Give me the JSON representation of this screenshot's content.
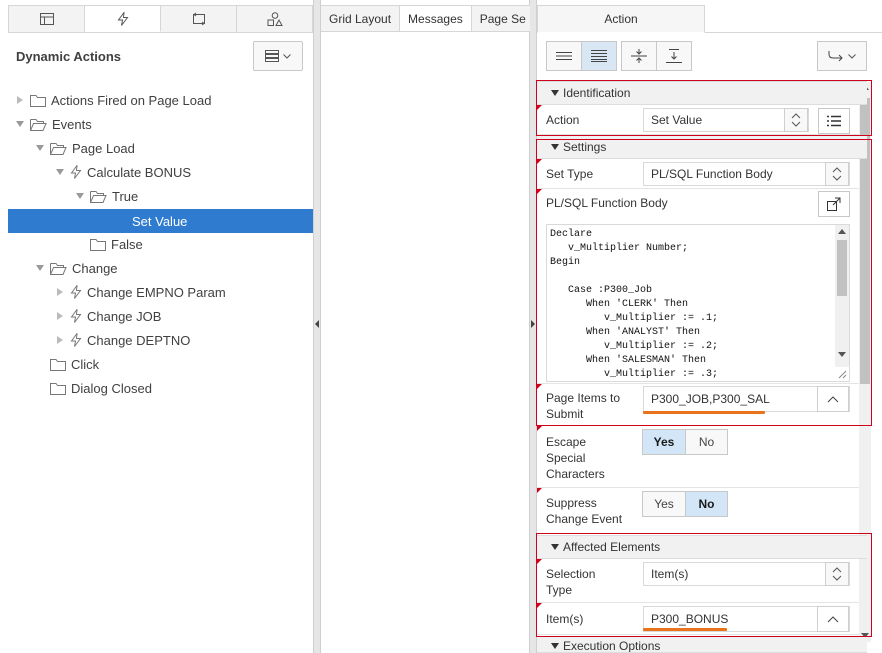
{
  "left": {
    "tabs": [
      {
        "icon": "grid-layout-icon"
      },
      {
        "icon": "dynamic-actions-icon"
      },
      {
        "icon": "processing-icon"
      },
      {
        "icon": "shared-components-icon"
      }
    ],
    "title": "Dynamic Actions",
    "tree": {
      "actions_fired": "Actions Fired on Page Load",
      "events": "Events",
      "page_load": "Page Load",
      "calc_bonus": "Calculate BONUS",
      "true": "True",
      "set_value": "Set Value",
      "false": "False",
      "change": "Change",
      "change_empno": "Change EMPNO Param",
      "change_job": "Change JOB",
      "change_deptno": "Change DEPTNO",
      "click": "Click",
      "dialog_closed": "Dialog Closed"
    }
  },
  "middle": {
    "tabs": [
      "Grid Layout",
      "Messages",
      "Page Se"
    ]
  },
  "right": {
    "tab": "Action",
    "sections": {
      "identification": "Identification",
      "settings": "Settings",
      "affected": "Affected Elements",
      "execution": "Execution Options"
    },
    "action": {
      "label": "Action",
      "value": "Set Value"
    },
    "set_type": {
      "label": "Set Type",
      "value": "PL/SQL Function Body"
    },
    "plsql": {
      "label": "PL/SQL Function Body",
      "code": "Declare\n   v_Multiplier Number;\nBegin\n\n   Case :P300_Job\n      When 'CLERK' Then\n         v_Multiplier := .1;\n      When 'ANALYST' Then\n         v_Multiplier := .2;\n      When 'SALESMAN' Then\n         v_Multiplier := .3;"
    },
    "page_items": {
      "label": "Page Items to Submit",
      "value": "P300_JOB,P300_SAL"
    },
    "escape": {
      "label": "Escape Special Characters",
      "yes": "Yes",
      "no": "No",
      "selected": "Yes"
    },
    "suppress": {
      "label": "Suppress Change Event",
      "yes": "Yes",
      "no": "No",
      "selected": "No"
    },
    "selection_type": {
      "label": "Selection Type",
      "value": "Item(s)"
    },
    "items": {
      "label": "Item(s)",
      "value": "P300_BONUS"
    }
  },
  "colors": {
    "selection": "#2e7bcf",
    "highlight_box": "#d0021b",
    "underline": "#e8731c",
    "toggle_on": "#d3e6f8"
  }
}
